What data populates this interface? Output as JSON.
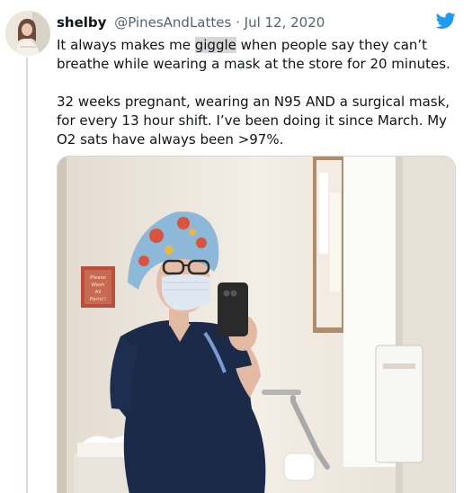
{
  "tweet": {
    "display_name": "shelby",
    "handle": "@PinesAndLattes",
    "separator": "·",
    "date": "Jul 12, 2020",
    "text_line1_before": "It always makes me ",
    "text_line1_highlight": "giggle",
    "text_line1_after": " when people say they can’t breathe while wearing a mask at the store for 20 minutes.",
    "text_para2": "32 weeks pregnant, wearing an N95 AND a surgical mask, for every 13 hour shift. I’ve been doing it since March. My O2 sats have always been >97%.",
    "platform_icon": "twitter-bird-icon",
    "media": {
      "description_icon": "photo",
      "sign_text_1": "Please",
      "sign_text_2": "Wash",
      "sign_text_3": "All",
      "sign_text_4": "Parts!!"
    }
  },
  "colors": {
    "twitter_blue": "#1d9bf0",
    "text_primary": "#0f1419",
    "text_secondary": "#536471",
    "scrub_navy": "#1b2a48",
    "wall": "#eee6dc"
  }
}
